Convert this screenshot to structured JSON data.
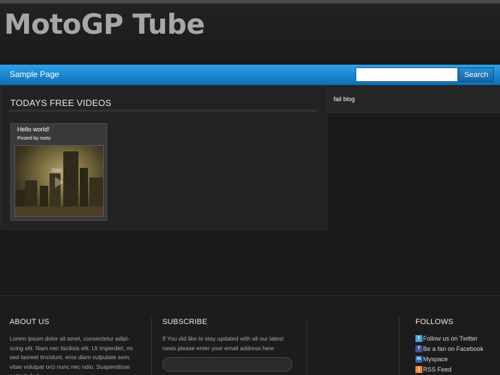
{
  "site": {
    "title": "MotoGP Tube"
  },
  "nav": {
    "items": [
      {
        "label": "Sample Page"
      }
    ],
    "search": {
      "placeholder": "",
      "button_label": "Search"
    }
  },
  "main": {
    "section_title": "TODAYS FREE VIDEOS",
    "videos": [
      {
        "title": "Hello world!",
        "meta": "Posted by moto",
        "thumbnail_icon": "play-icon"
      }
    ]
  },
  "sidebar": {
    "links": [
      {
        "label": "fail blog"
      }
    ]
  },
  "footer": {
    "about": {
      "heading": "ABOUT US",
      "text": "Lorem ipsum dolor sit amet, consectetur adipi-scing elit. Nam nec facilisis elit. Ut imperdiet, mi sed laoreet tincidunt, eros diam vulputate sem, vitae volutpat orci nunc nec odio. Suspendisse potenti. [...]"
    },
    "subscribe": {
      "heading": "SUBSCRIBE",
      "text": "If You did like to stay updated with all our latest news please enter your email address here",
      "email_placeholder": ""
    },
    "follows": {
      "heading": "FOLLOWS",
      "items": [
        {
          "label": "Follow us on Twitter",
          "icon": "twitter-icon",
          "color": "#4aa3df"
        },
        {
          "label": "Be a fan on Facebook",
          "icon": "facebook-icon",
          "color": "#3b5998"
        },
        {
          "label": "Myspace",
          "icon": "myspace-icon",
          "color": "#2a6fb5"
        },
        {
          "label": "RSS Feed",
          "icon": "rss-icon",
          "color": "#f08a24"
        }
      ]
    }
  },
  "colors": {
    "nav_blue": "#1b86cf",
    "background": "#1a1a1a",
    "title_gray": "#a7a7a7"
  }
}
